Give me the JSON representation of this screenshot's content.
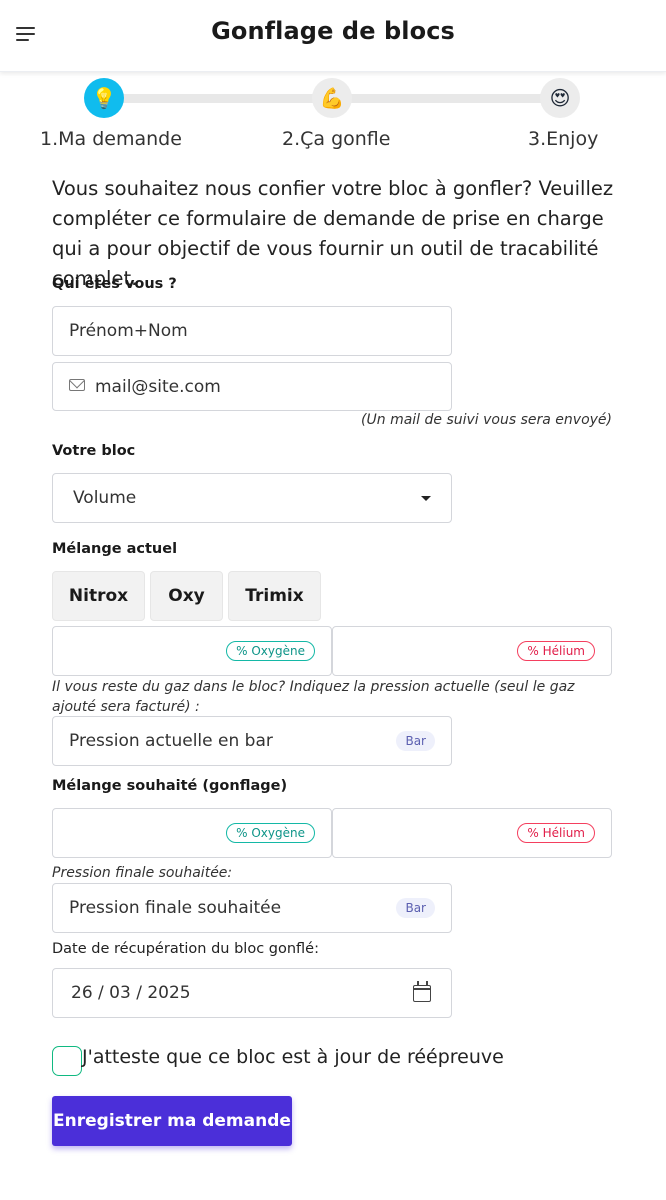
{
  "header": {
    "title": "Gonflage de blocs",
    "menu_icon": "hamburger-menu-icon"
  },
  "stepper": {
    "steps": [
      {
        "label": "1.Ma demande",
        "icon": "💡",
        "active": true
      },
      {
        "label": "2.Ça gonfle",
        "icon": "💪",
        "active": false
      },
      {
        "label": "3.Enjoy",
        "icon": "😍",
        "active": false
      }
    ],
    "active_color": "#10bcee"
  },
  "intro_text": "Vous souhaitez nous confier votre bloc à gonfler? Veuillez compléter ce formulaire de demande de prise en charge qui a pour objectif de vous fournir un outil de tracabilité complet.",
  "identity": {
    "label": "Qui êtes vous ?",
    "name_placeholder": "Prénom+Nom",
    "email_placeholder": "mail@site.com",
    "email_hint": "(Un mail de suivi vous sera envoyé)"
  },
  "bloc": {
    "label": "Votre bloc",
    "volume_placeholder": "Volume"
  },
  "current_mix": {
    "label": "Mélange actuel",
    "gas_options": [
      "Nitrox",
      "Oxy",
      "Trimix"
    ],
    "oxygen_badge": "% Oxygène",
    "helium_badge": "% Hélium",
    "pressure_hint": "Il vous reste du gaz dans le bloc? Indiquez la pression actuelle (seul le gaz ajouté sera facturé) :",
    "pressure_placeholder": "Pression actuelle en bar",
    "pressure_unit": "Bar"
  },
  "desired_mix": {
    "label": "Mélange souhaité (gonflage)",
    "oxygen_badge": "% Oxygène",
    "helium_badge": "% Hélium",
    "final_pressure_hint": "Pression finale souhaitée:",
    "final_pressure_placeholder": "Pression finale souhaitée",
    "pressure_unit": "Bar"
  },
  "pickup": {
    "label": "Date de récupération du bloc gonflé:",
    "date_value": "26 / 03 / 2025"
  },
  "attestation": {
    "label": "J'atteste que ce bloc est à jour de réépreuve",
    "checked": false
  },
  "submit": {
    "label": "Enregistrer ma demande"
  },
  "colors": {
    "primary": "#4b2fd9",
    "oxygen": "#0d9488",
    "helium": "#e11d48",
    "checkbox_border": "#10b981"
  }
}
